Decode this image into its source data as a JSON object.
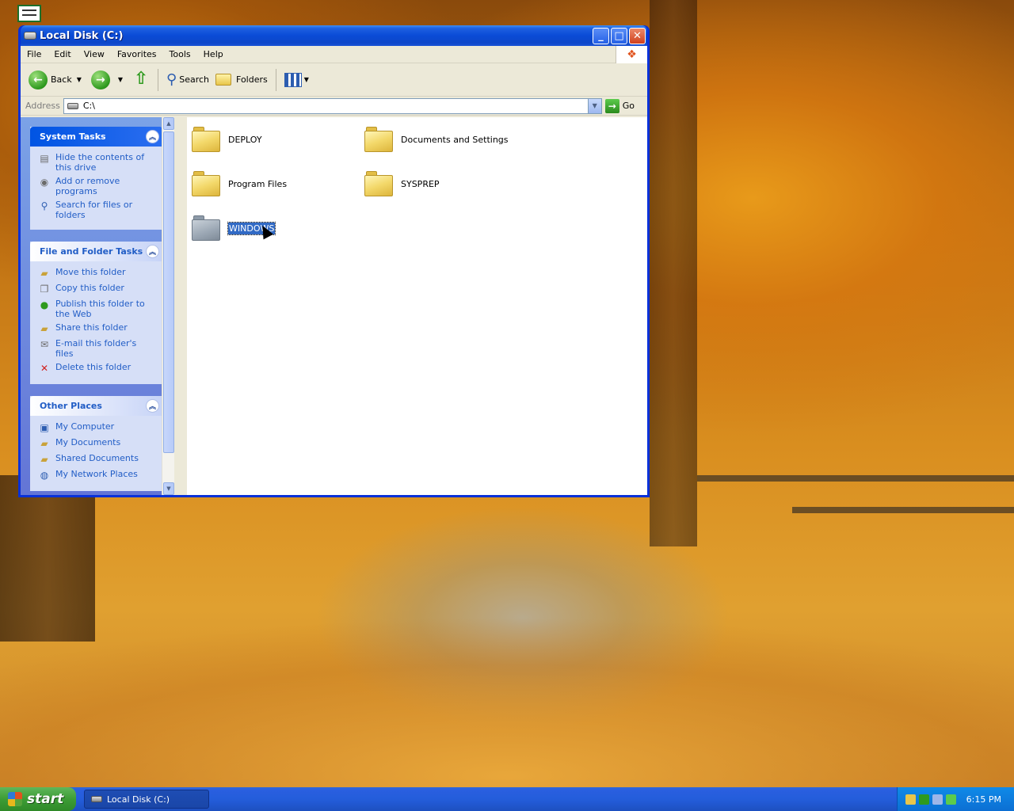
{
  "window": {
    "title": "Local Disk (C:)",
    "minimize": "_",
    "maximize": "□",
    "close": "✕"
  },
  "menu": [
    "File",
    "Edit",
    "View",
    "Favorites",
    "Tools",
    "Help"
  ],
  "toolbar": {
    "back_label": "Back",
    "search_label": "Search",
    "folders_label": "Folders"
  },
  "address": {
    "label": "Address",
    "value": "C:\\",
    "go_label": "Go"
  },
  "taskpane": {
    "system_tasks": {
      "title": "System Tasks",
      "items": [
        {
          "label": "Hide the contents of this drive",
          "icon": "drive-icon"
        },
        {
          "label": "Add or remove programs",
          "icon": "programs-icon"
        },
        {
          "label": "Search for files or folders",
          "icon": "search-icon"
        }
      ]
    },
    "file_folder_tasks": {
      "title": "File and Folder Tasks",
      "items": [
        {
          "label": "Move this folder",
          "icon": "move-icon"
        },
        {
          "label": "Copy this folder",
          "icon": "copy-icon"
        },
        {
          "label": "Publish this folder to the Web",
          "icon": "globe-icon"
        },
        {
          "label": "Share this folder",
          "icon": "share-icon"
        },
        {
          "label": "E-mail this folder's files",
          "icon": "email-icon"
        },
        {
          "label": "Delete this folder",
          "icon": "delete-icon"
        }
      ]
    },
    "other_places": {
      "title": "Other Places",
      "items": [
        {
          "label": "My Computer",
          "icon": "computer-icon"
        },
        {
          "label": "My Documents",
          "icon": "documents-icon"
        },
        {
          "label": "Shared Documents",
          "icon": "folder-icon"
        },
        {
          "label": "My Network Places",
          "icon": "network-icon"
        }
      ]
    }
  },
  "files": [
    {
      "name": "DEPLOY",
      "selected": false
    },
    {
      "name": "Documents and Settings",
      "selected": false
    },
    {
      "name": "Program Files",
      "selected": false
    },
    {
      "name": "SYSPREP",
      "selected": false
    },
    {
      "name": "WINDOWS",
      "selected": true
    }
  ],
  "taskbar": {
    "start_label": "start",
    "task_item": "Local Disk (C:)",
    "clock": "6:15 PM"
  }
}
